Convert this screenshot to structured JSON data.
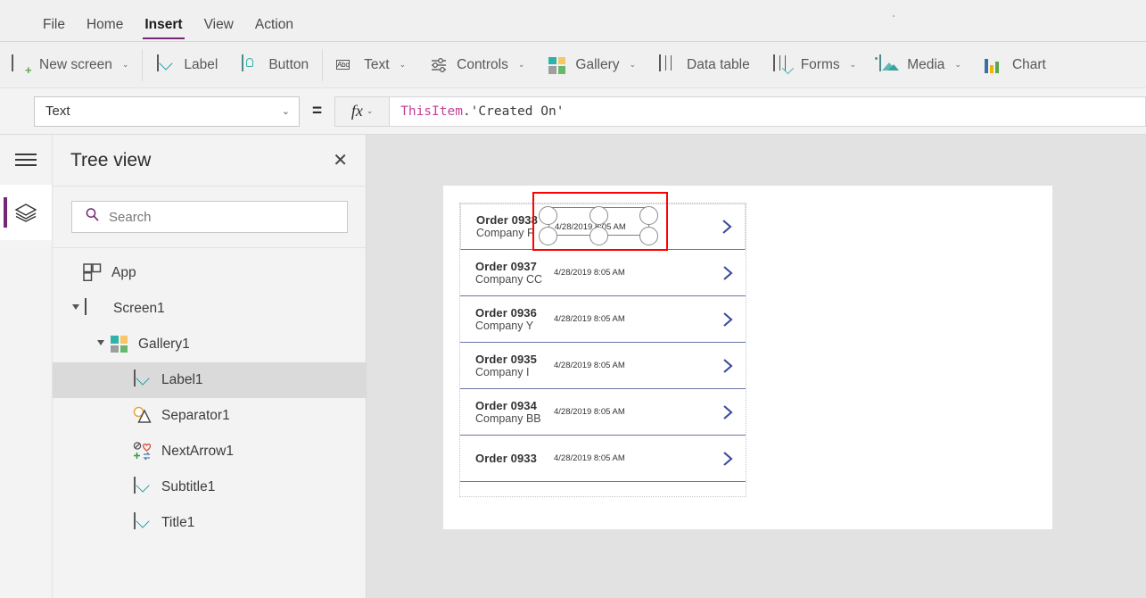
{
  "app": {
    "menu_items": [
      {
        "label": "File",
        "active": false
      },
      {
        "label": "Home",
        "active": false
      },
      {
        "label": "Insert",
        "active": true
      },
      {
        "label": "View",
        "active": false
      },
      {
        "label": "Action",
        "active": false
      }
    ],
    "accent_color": "#742774"
  },
  "ribbon": {
    "items": [
      {
        "label": "New screen",
        "icon": "new-screen-icon",
        "has_chevron": true
      },
      {
        "label": "Label",
        "icon": "label-icon",
        "has_chevron": false
      },
      {
        "label": "Button",
        "icon": "button-icon",
        "has_chevron": false
      },
      {
        "label": "Text",
        "icon": "text-abc-icon",
        "has_chevron": true
      },
      {
        "label": "Controls",
        "icon": "controls-sliders-icon",
        "has_chevron": true
      },
      {
        "label": "Gallery",
        "icon": "gallery-grid-icon",
        "has_chevron": true
      },
      {
        "label": "Data table",
        "icon": "data-table-icon",
        "has_chevron": false
      },
      {
        "label": "Forms",
        "icon": "forms-icon",
        "has_chevron": true
      },
      {
        "label": "Media",
        "icon": "media-image-icon",
        "has_chevron": true
      },
      {
        "label": "Chart",
        "icon": "chart-bars-icon",
        "has_chevron": false
      }
    ],
    "chevron_glyph": "⌄",
    "gallery_icon_colors": [
      "#2fb3a8",
      "#f6c667",
      "#9e9e9e",
      "#66b96a"
    ],
    "chart_icon_colors": [
      "#3a6ea5",
      "#f0b400",
      "#5aa64b"
    ],
    "abc_text": "Abc"
  },
  "formula_bar": {
    "property": "Text",
    "equals": "=",
    "fx_label": "fx",
    "chevron_glyph": "⌄",
    "formula_identifier": "ThisItem",
    "formula_rest": ".'Created On'",
    "identifier_color": "#c3419b"
  },
  "rail": {
    "hamburger_name": "hamburger-menu-icon",
    "active_tool": "tree-view-layers-icon"
  },
  "tree_view": {
    "title": "Tree view",
    "close_glyph": "✕",
    "search_placeholder": "Search",
    "items": [
      {
        "label": "App",
        "icon": "app-icon",
        "indent": 0,
        "twisty": "none",
        "selected": false
      },
      {
        "label": "Screen1",
        "icon": "screen-icon",
        "indent": 0,
        "twisty": "expanded",
        "selected": false
      },
      {
        "label": "Gallery1",
        "icon": "gallery-icon",
        "indent": 1,
        "twisty": "expanded",
        "selected": false
      },
      {
        "label": "Label1",
        "icon": "label-icon",
        "indent": 2,
        "twisty": "none",
        "selected": true
      },
      {
        "label": "Separator1",
        "icon": "shapes-icon",
        "indent": 2,
        "twisty": "none",
        "selected": false
      },
      {
        "label": "NextArrow1",
        "icon": "icons-icon",
        "indent": 2,
        "twisty": "none",
        "selected": false
      },
      {
        "label": "Subtitle1",
        "icon": "label-icon",
        "indent": 2,
        "twisty": "none",
        "selected": false
      },
      {
        "label": "Title1",
        "icon": "label-icon",
        "indent": 2,
        "twisty": "none",
        "selected": false
      }
    ]
  },
  "canvas": {
    "gallery_rows": [
      {
        "title": "Order 0938",
        "subtitle": "Company F",
        "date": "4/28/2019 8:05 AM",
        "selected": true
      },
      {
        "title": "Order 0937",
        "subtitle": "Company CC",
        "date": "4/28/2019 8:05 AM",
        "selected": false
      },
      {
        "title": "Order 0936",
        "subtitle": "Company Y",
        "date": "4/28/2019 8:05 AM",
        "selected": false
      },
      {
        "title": "Order 0935",
        "subtitle": "Company I",
        "date": "4/28/2019 8:05 AM",
        "selected": false
      },
      {
        "title": "Order 0934",
        "subtitle": "Company BB",
        "date": "4/28/2019 8:05 AM",
        "selected": false
      },
      {
        "title": "Order 0933",
        "subtitle": "",
        "date": "4/28/2019 8:05 AM",
        "selected": false
      }
    ],
    "chevron_color": "#3c4a9e",
    "separator_color": "#6b74a8",
    "selection_color": "#ff0000"
  }
}
